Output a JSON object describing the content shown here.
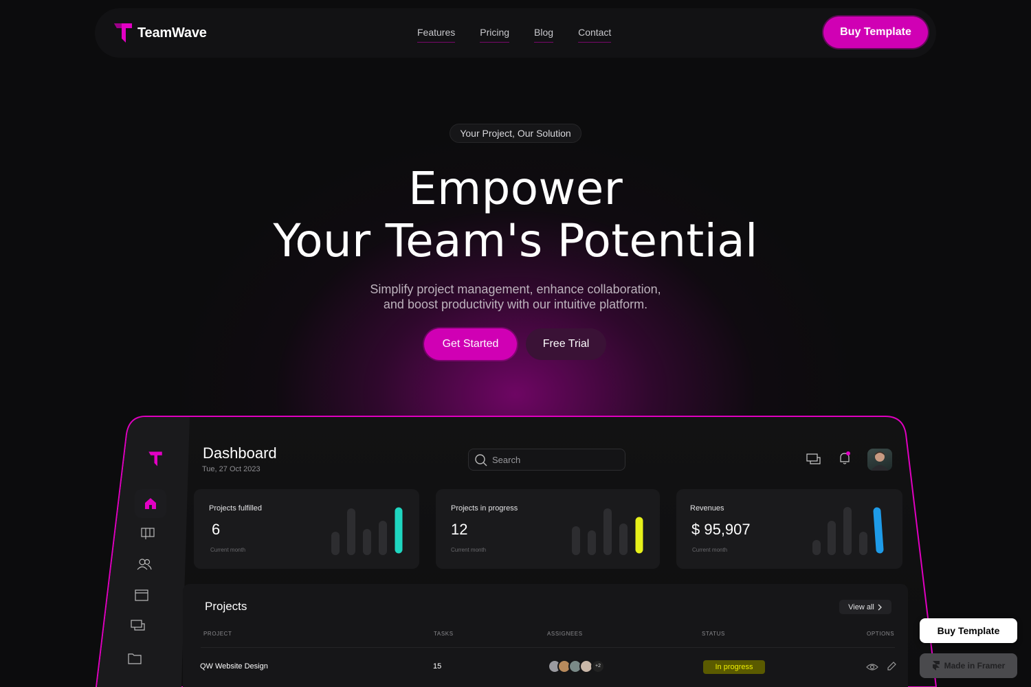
{
  "nav": {
    "brand": "TeamWave",
    "links": [
      "Features",
      "Pricing",
      "Blog",
      "Contact"
    ],
    "buy_label": "Buy Template"
  },
  "hero": {
    "eyebrow": "Your Project, Our Solution",
    "title_line1": "Empower",
    "title_line2": "Your Team's Potential",
    "subtitle_line1": "Simplify project management, enhance collaboration,",
    "subtitle_line2": "and boost productivity with our intuitive platform.",
    "cta_primary": "Get Started",
    "cta_secondary": "Free Trial"
  },
  "dashboard": {
    "title": "Dashboard",
    "date": "Tue, 27 Oct 2023",
    "search_placeholder": "Search",
    "cards": [
      {
        "label": "Projects fulfilled",
        "value": "6",
        "note": "Current month",
        "accent": "#1fd6c0"
      },
      {
        "label": "Projects in progress",
        "value": "12",
        "note": "Current month",
        "accent": "#e6f01a"
      },
      {
        "label": "Revenues",
        "value": "$ 95,907",
        "note": "Current month",
        "accent": "#1e9be8"
      }
    ],
    "projects": {
      "title": "Projects",
      "view_all": "View all",
      "columns": [
        "PROJECT",
        "TASKS",
        "ASSIGNEES",
        "STATUS",
        "OPTIONS"
      ],
      "rows": [
        {
          "project": "QW Website Design",
          "tasks": "15",
          "assignees_more": "+2",
          "status": "In progress"
        }
      ]
    }
  },
  "framer": {
    "buy_label": "Buy Template",
    "made_label": "Made in Framer"
  },
  "colors": {
    "accent": "#d000b4",
    "background": "#0c0c0d",
    "status_in_progress": "#f0f000"
  }
}
